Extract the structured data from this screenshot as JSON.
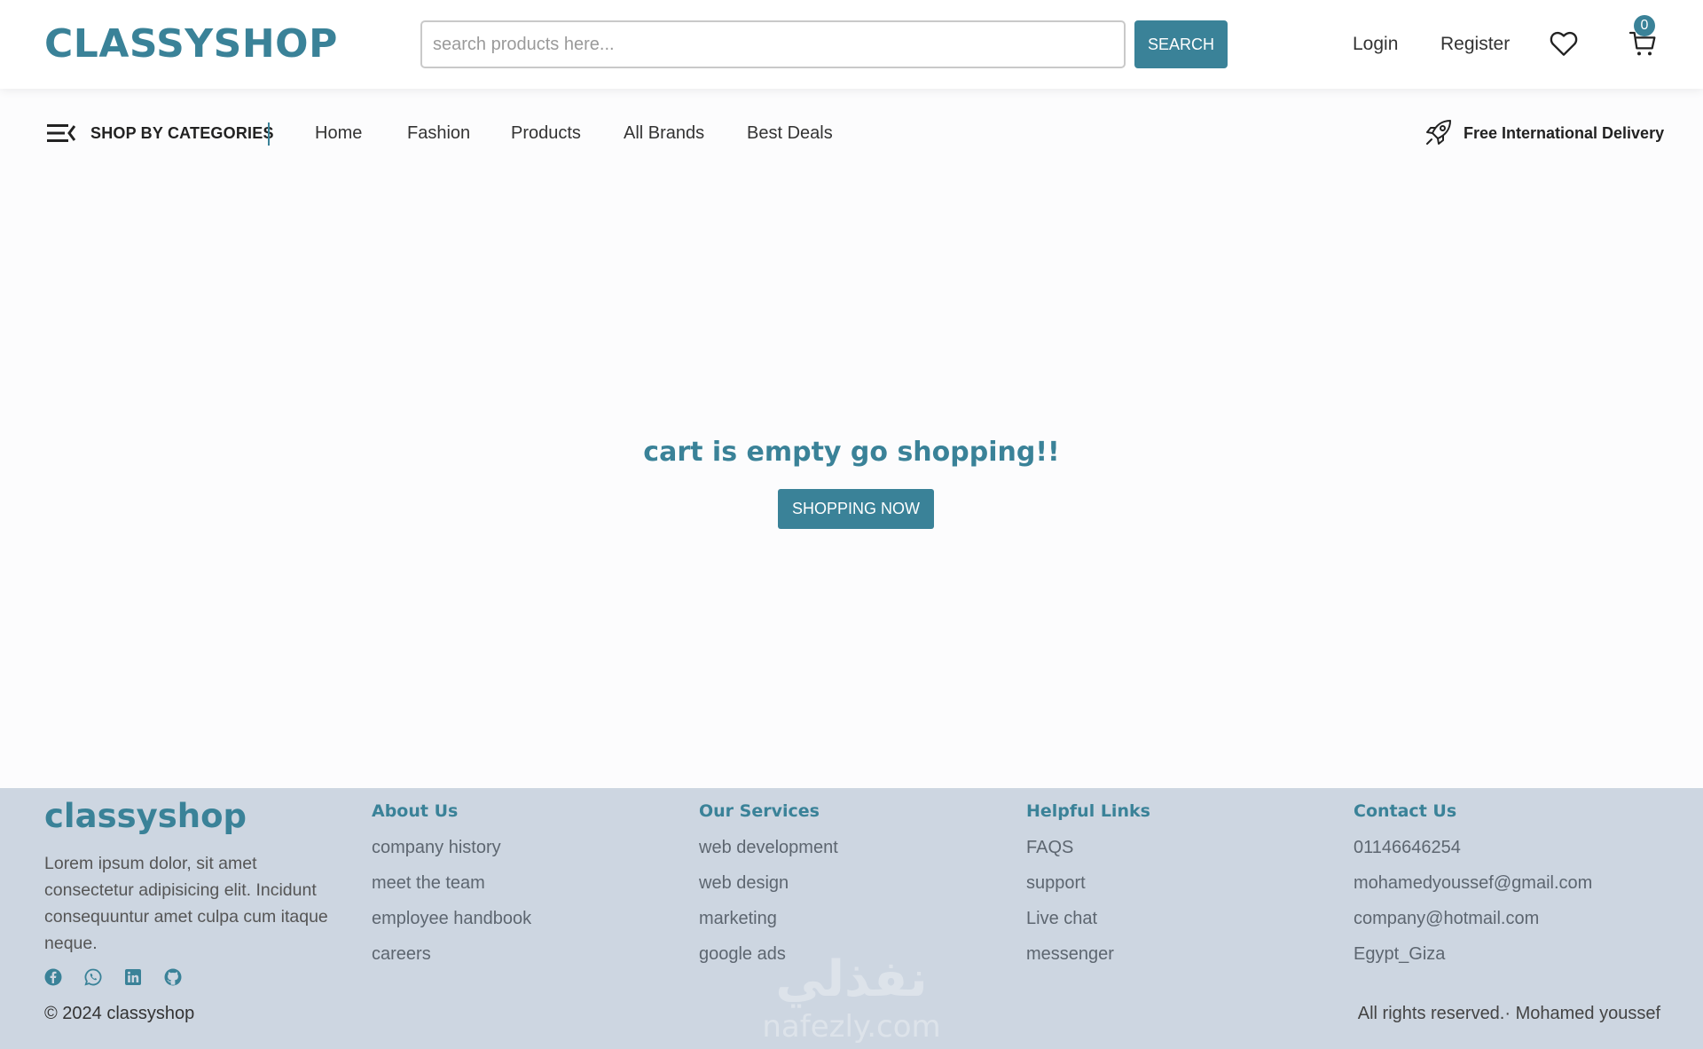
{
  "brand": {
    "logo_text": "CLASSYSHOP",
    "accent": "#3a8298"
  },
  "search": {
    "placeholder": "search products here...",
    "value": "",
    "button_label": "SEARCH"
  },
  "header": {
    "login_label": "Login",
    "register_label": "Register",
    "wishlist_icon": "heart-icon",
    "cart_icon": "cart-icon",
    "cart_count": "0"
  },
  "nav": {
    "categories_label": "SHOP BY CATEGORIES",
    "links": [
      "Home",
      "Fashion",
      "Products",
      "All Brands",
      "Best Deals"
    ],
    "delivery_label": "Free International Delivery"
  },
  "main": {
    "empty_message": "cart is empty go shopping!!",
    "shop_button_label": "SHOPPING NOW"
  },
  "footer": {
    "logo_text": "classyshop",
    "description": "Lorem ipsum dolor, sit amet consectetur adipisicing elit. Incidunt consequuntur amet culpa cum itaque neque.",
    "social_icons": [
      "facebook-icon",
      "whatsapp-icon",
      "linkedin-icon",
      "github-icon"
    ],
    "columns": [
      {
        "title": "About Us",
        "items": [
          "company history",
          "meet the team",
          "employee handbook",
          "careers"
        ]
      },
      {
        "title": "Our Services",
        "items": [
          "web development",
          "web design",
          "marketing",
          "google ads"
        ]
      },
      {
        "title": "Helpful Links",
        "items": [
          "FAQS",
          "support",
          "Live chat",
          "messenger"
        ]
      },
      {
        "title": "Contact Us",
        "items": [
          "01146646254",
          "mohamedyoussef@gmail.com",
          "company@hotmail.com",
          "Egypt_Giza"
        ]
      }
    ],
    "copyright": "© 2024 classyshop",
    "rights": "All rights reserved.· Mohamed youssef",
    "background": "#cdd6e1"
  },
  "watermark": {
    "text_arabic": "نفذلي",
    "text_latin": "nafezly.com"
  }
}
